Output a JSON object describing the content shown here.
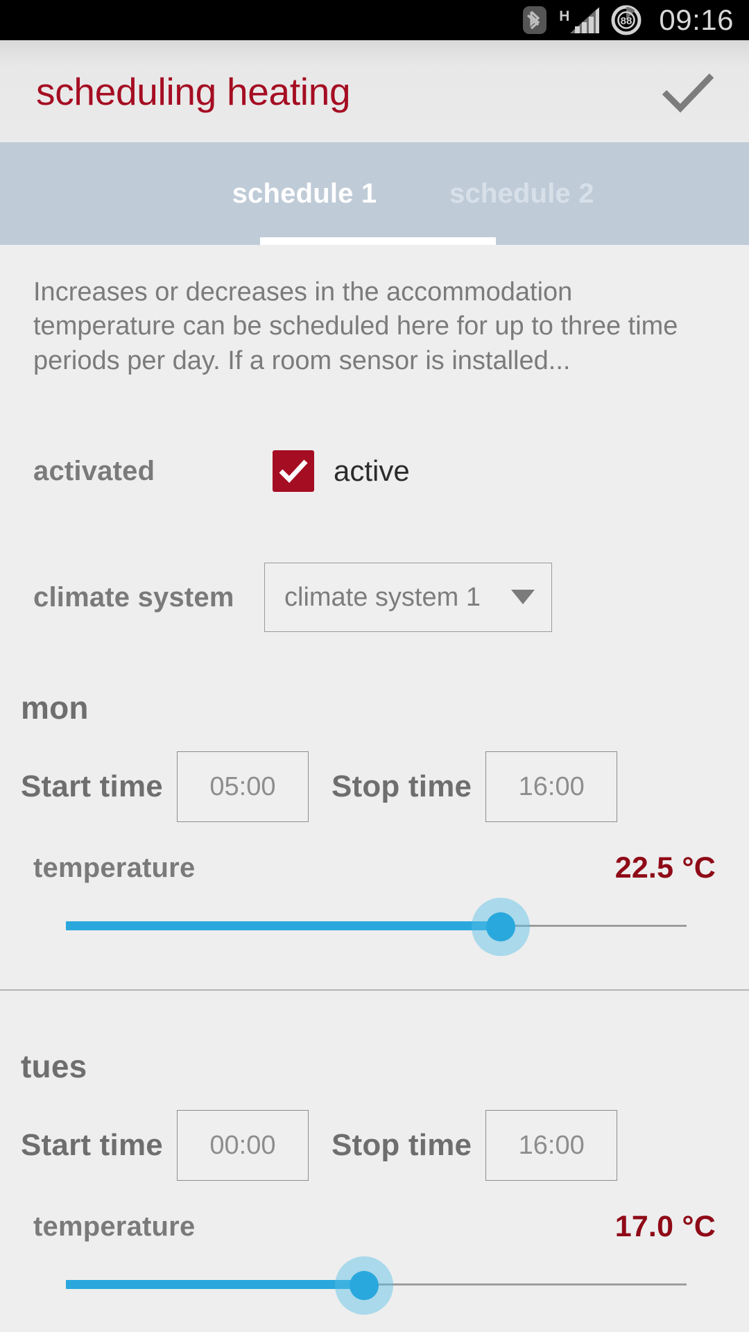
{
  "status_bar": {
    "bluetooth_icon": "bluetooth-icon",
    "network_type": "H",
    "signal_icon": "signal-bars-icon",
    "battery_level": "88",
    "time": "09:16"
  },
  "action_bar": {
    "title": "scheduling heating",
    "confirm_icon": "checkmark-icon",
    "title_color": "#a50d22"
  },
  "tabs": [
    {
      "label": "schedule 1",
      "selected": true
    },
    {
      "label": "schedule 2",
      "selected": false
    }
  ],
  "description": "Increases or decreases in the accommodation temperature can be scheduled here for up to three time periods per day. If a room sensor is installed...",
  "activated": {
    "label": "activated",
    "checkbox_label": "active",
    "checked": true,
    "checkbox_color": "#a50d22"
  },
  "climate_system": {
    "label": "climate system",
    "selected_value": "climate system 1",
    "dropdown_icon": "chevron-down-icon"
  },
  "days": [
    {
      "name": "mon",
      "start_label": "Start time",
      "start_value": "05:00",
      "stop_label": "Stop time",
      "stop_value": "16:00",
      "temperature_label": "temperature",
      "temperature_value": "22.5 °C",
      "slider_percent": 70
    },
    {
      "name": "tues",
      "start_label": "Start time",
      "start_value": "00:00",
      "stop_label": "Stop time",
      "stop_value": "16:00",
      "temperature_label": "temperature",
      "temperature_value": "17.0 °C",
      "slider_percent": 48
    }
  ],
  "colors": {
    "accent_red": "#a50d22",
    "temp_red": "#8f0a17",
    "slider_blue": "#29a8dd",
    "tab_bar": "#bfcbd7",
    "background": "#eeeeee"
  }
}
